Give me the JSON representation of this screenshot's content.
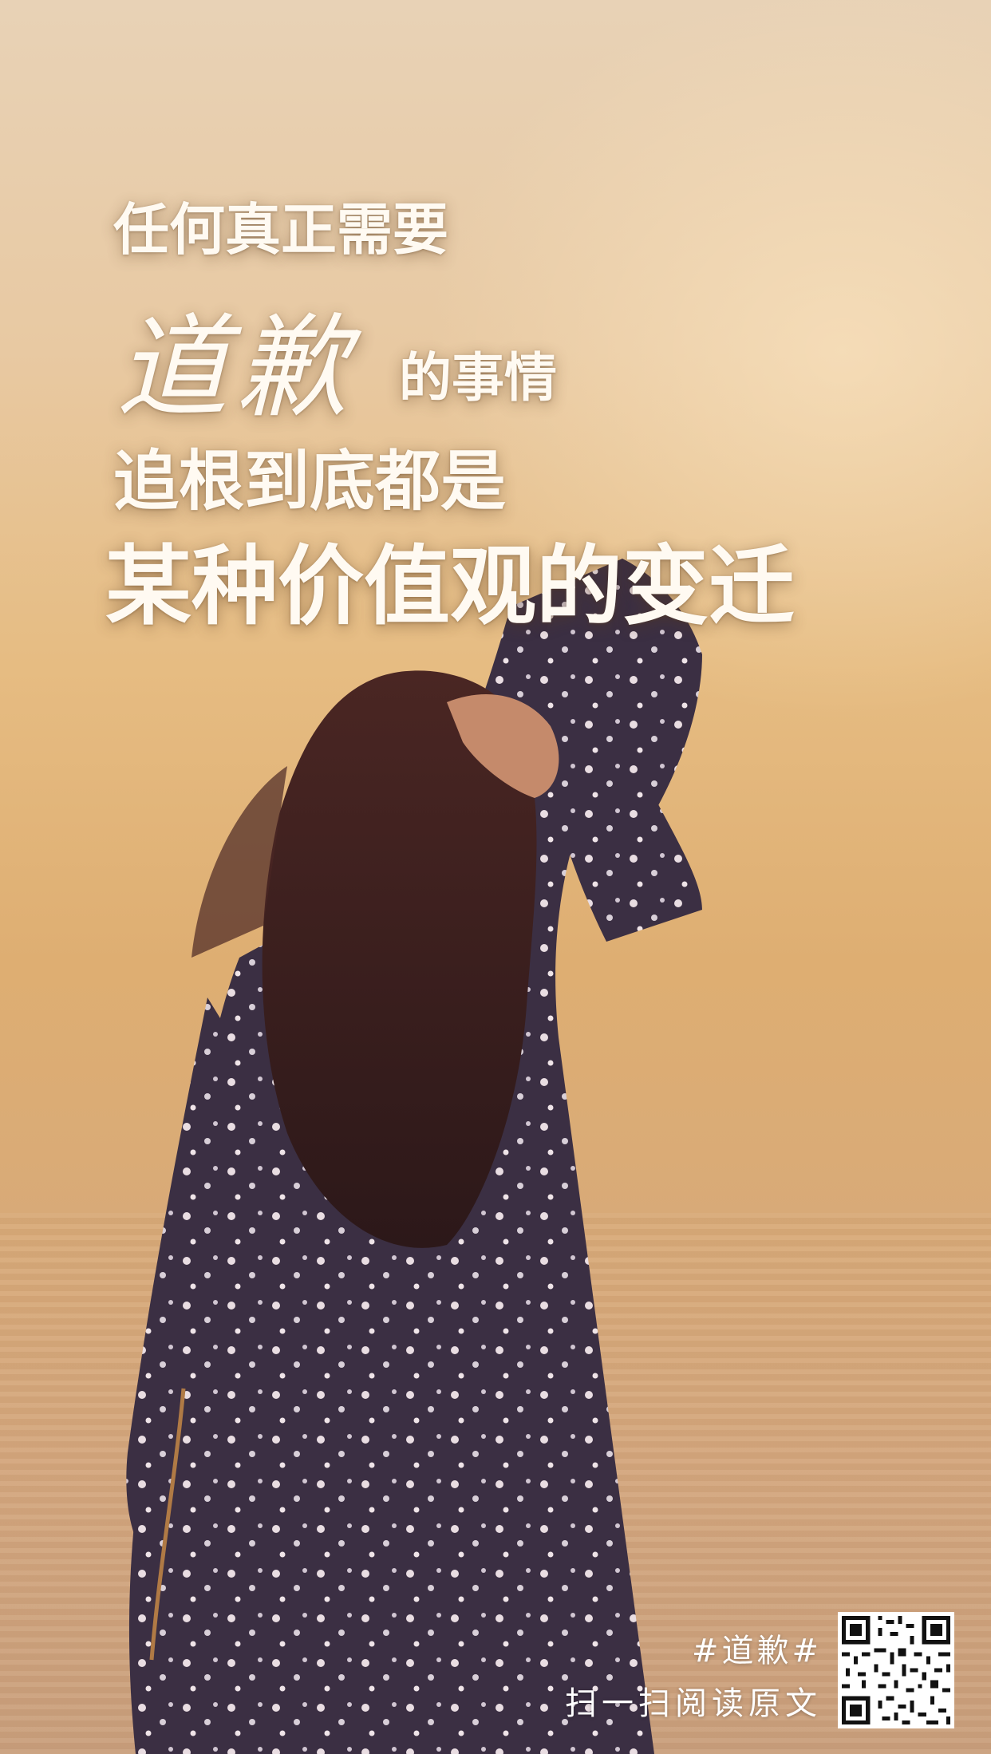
{
  "headline": {
    "line1": "任何真正需要",
    "line2": "道歉",
    "line3": "的事情",
    "line4": "追根到底都是",
    "line5": "某种价值观的变迁"
  },
  "footer": {
    "hashtag": "#道歉#",
    "cta": "扫一扫阅读原文"
  },
  "colors": {
    "text": "#fffaf2",
    "dress": "#3b2f43",
    "hair": "#3a1f1e"
  },
  "icons": {
    "qr": "qr-code-icon"
  }
}
